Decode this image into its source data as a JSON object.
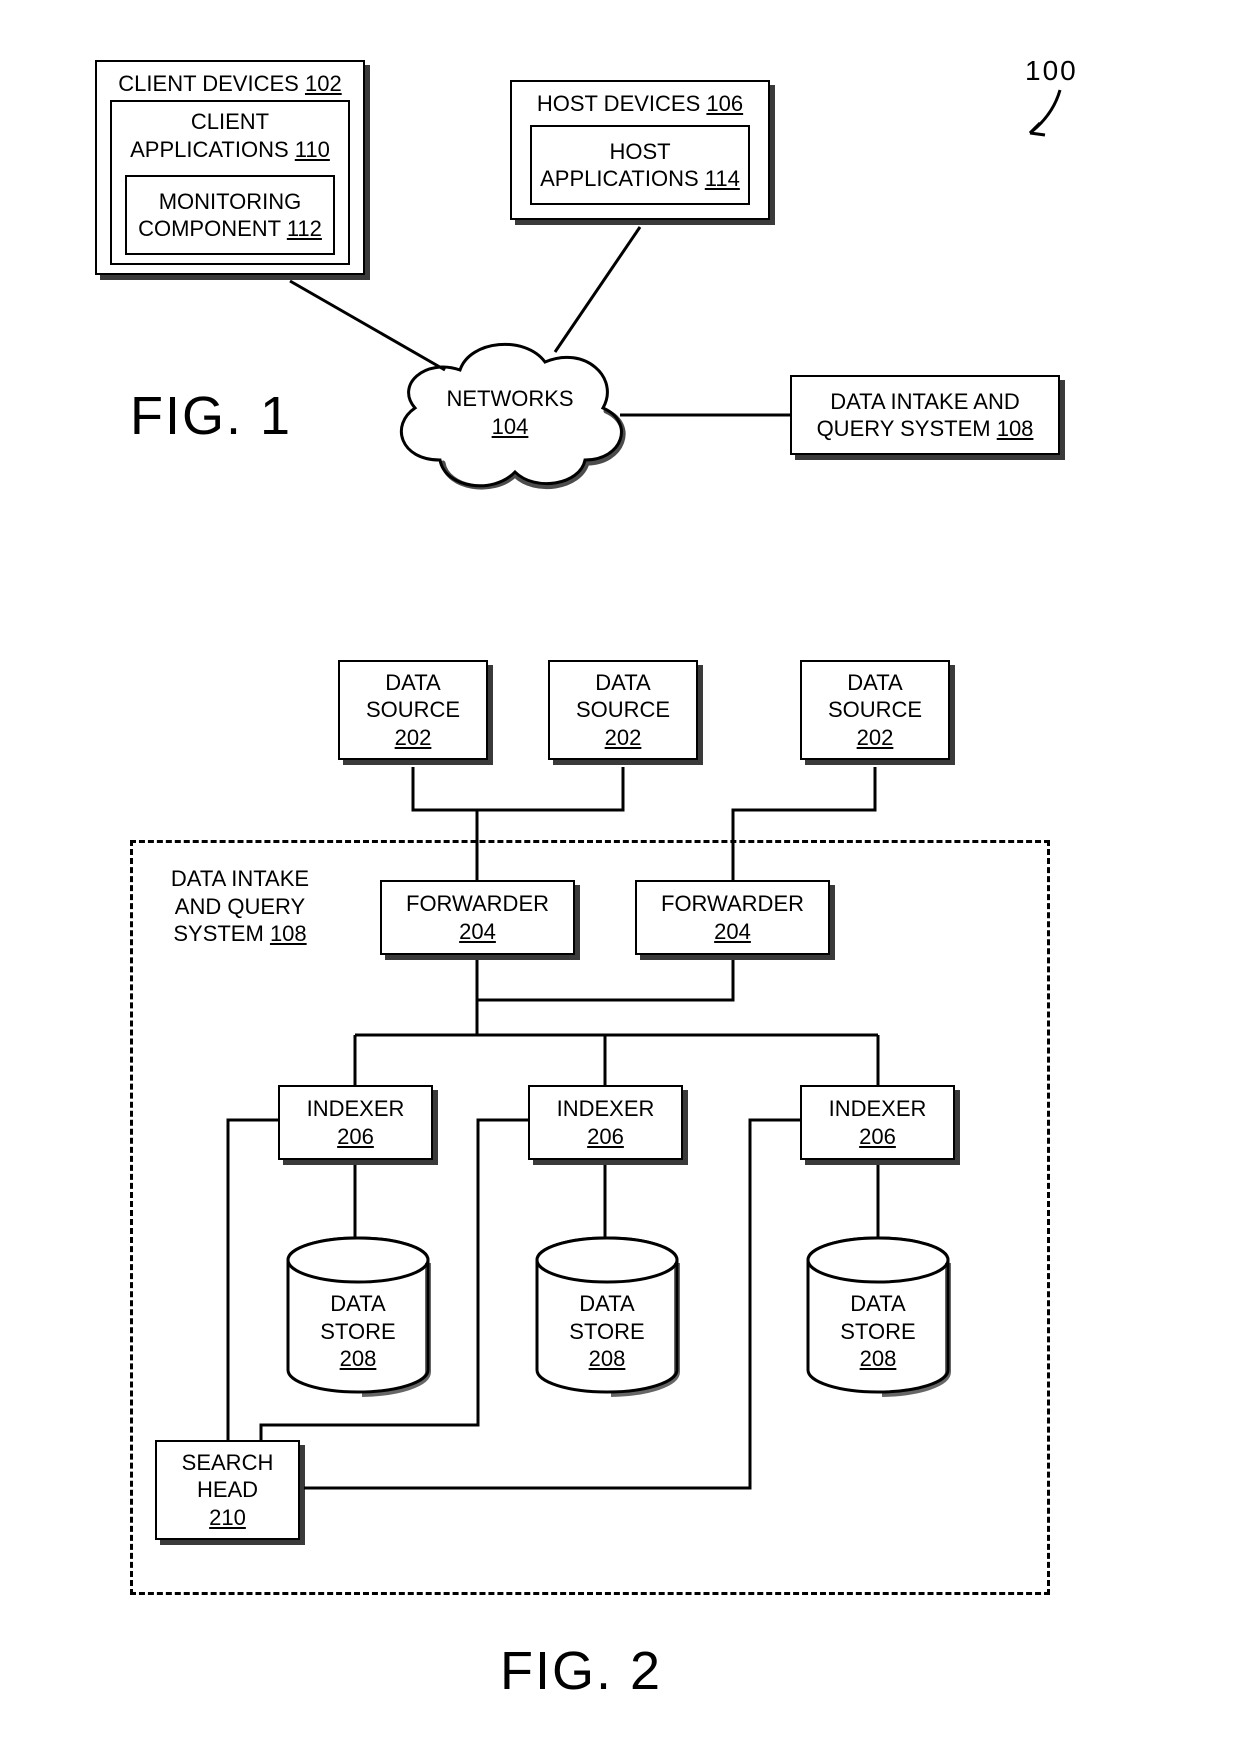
{
  "fig1": {
    "label": "FIG. 1",
    "ref": "100",
    "client_devices": {
      "title": "CLIENT DEVICES",
      "ref": "102"
    },
    "client_apps": {
      "title": "CLIENT\nAPPLICATIONS",
      "ref": "110"
    },
    "monitor": {
      "title": "MONITORING\nCOMPONENT",
      "ref": "112"
    },
    "host_devices": {
      "title": "HOST DEVICES",
      "ref": "106"
    },
    "host_apps": {
      "title": "HOST\nAPPLICATIONS",
      "ref": "114"
    },
    "networks": {
      "title": "NETWORKS",
      "ref": "104"
    },
    "diqs": {
      "title": "DATA INTAKE AND\nQUERY SYSTEM",
      "ref": "108"
    }
  },
  "fig2": {
    "label": "FIG. 2",
    "data_source": {
      "title": "DATA\nSOURCE",
      "ref": "202"
    },
    "diqs_label": {
      "title": "DATA INTAKE\nAND QUERY\nSYSTEM",
      "ref": "108"
    },
    "forwarder": {
      "title": "FORWARDER",
      "ref": "204"
    },
    "indexer": {
      "title": "INDEXER",
      "ref": "206"
    },
    "data_store": {
      "title": "DATA\nSTORE",
      "ref": "208"
    },
    "search_head": {
      "title": "SEARCH\nHEAD",
      "ref": "210"
    }
  }
}
